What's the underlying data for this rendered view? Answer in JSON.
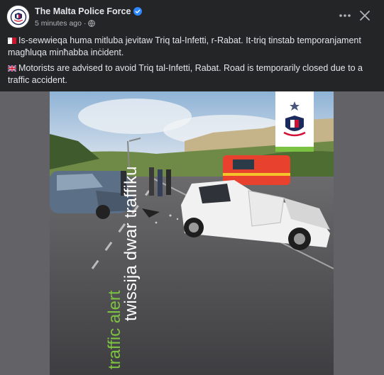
{
  "header": {
    "page_name": "The Malta Police Force",
    "timestamp": "5 minutes ago",
    "verified": true,
    "privacy_icon": "globe-icon",
    "more_icon": "more-horizontal-icon",
    "close_icon": "close-icon"
  },
  "post": {
    "maltese_text": "Is-sewwieqa huma mitluba jevitaw Triq tal-Infetti, r-Rabat. It-triq tinstab temporanjament magħluqa minħabba inċident.",
    "english_text": "Motorists are advised to avoid Triq tal-Infetti, Rabat. Road is temporarily closed due to a traffic accident.",
    "maltese_flag_icon": "malta-flag-icon",
    "english_flag_icon": "uk-flag-icon"
  },
  "image": {
    "overlay_maltese": "twissija dwar traffiku",
    "overlay_english": "traffic alert",
    "accent_color": "#7cc242",
    "description_icon": "police-logo-icon"
  },
  "colors": {
    "background": "#242526",
    "text_primary": "#e4e6eb",
    "text_secondary": "#b0b3b8",
    "verified_blue": "#2d88ff",
    "media_backdrop": "#626267"
  }
}
